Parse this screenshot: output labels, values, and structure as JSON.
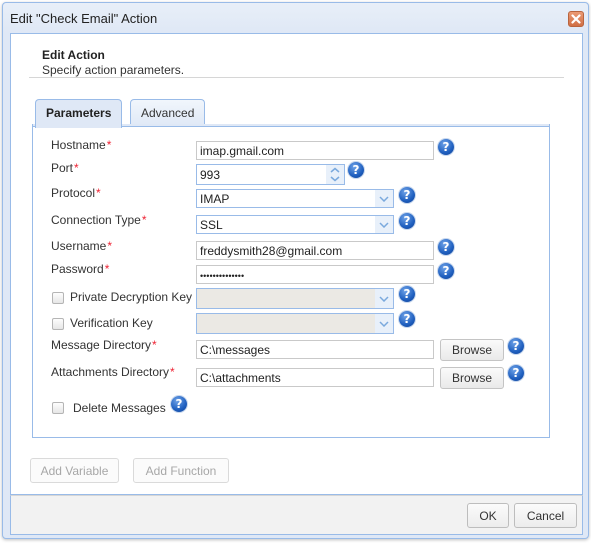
{
  "window": {
    "title": "Edit \"Check Email\" Action",
    "close_icon": "close-icon"
  },
  "header": {
    "title": "Edit Action",
    "subtitle": "Specify action parameters."
  },
  "tabs": [
    {
      "label": "Parameters",
      "active": true
    },
    {
      "label": "Advanced",
      "active": false
    }
  ],
  "form": {
    "required_marker": "*",
    "hostname": {
      "label": "Hostname",
      "value": "imap.gmail.com"
    },
    "port": {
      "label": "Port",
      "value": "993"
    },
    "protocol": {
      "label": "Protocol",
      "value": "IMAP"
    },
    "connection_type": {
      "label": "Connection Type",
      "value": "SSL"
    },
    "username": {
      "label": "Username",
      "value": "freddysmith28@gmail.com"
    },
    "password": {
      "label": "Password",
      "value": "••••••••••••••"
    },
    "private_decryption_key": {
      "label": "Private Decryption Key",
      "checked": false,
      "value": ""
    },
    "verification_key": {
      "label": "Verification Key",
      "checked": false,
      "value": ""
    },
    "message_directory": {
      "label": "Message Directory",
      "value": "C:\\messages",
      "browse_label": "Browse"
    },
    "attachments_directory": {
      "label": "Attachments Directory",
      "value": "C:\\attachments",
      "browse_label": "Browse"
    },
    "delete_messages": {
      "label": "Delete Messages",
      "checked": false
    },
    "help_glyph": "?"
  },
  "actions": {
    "add_variable": "Add Variable",
    "add_function": "Add Function"
  },
  "footer": {
    "ok": "OK",
    "cancel": "Cancel"
  }
}
